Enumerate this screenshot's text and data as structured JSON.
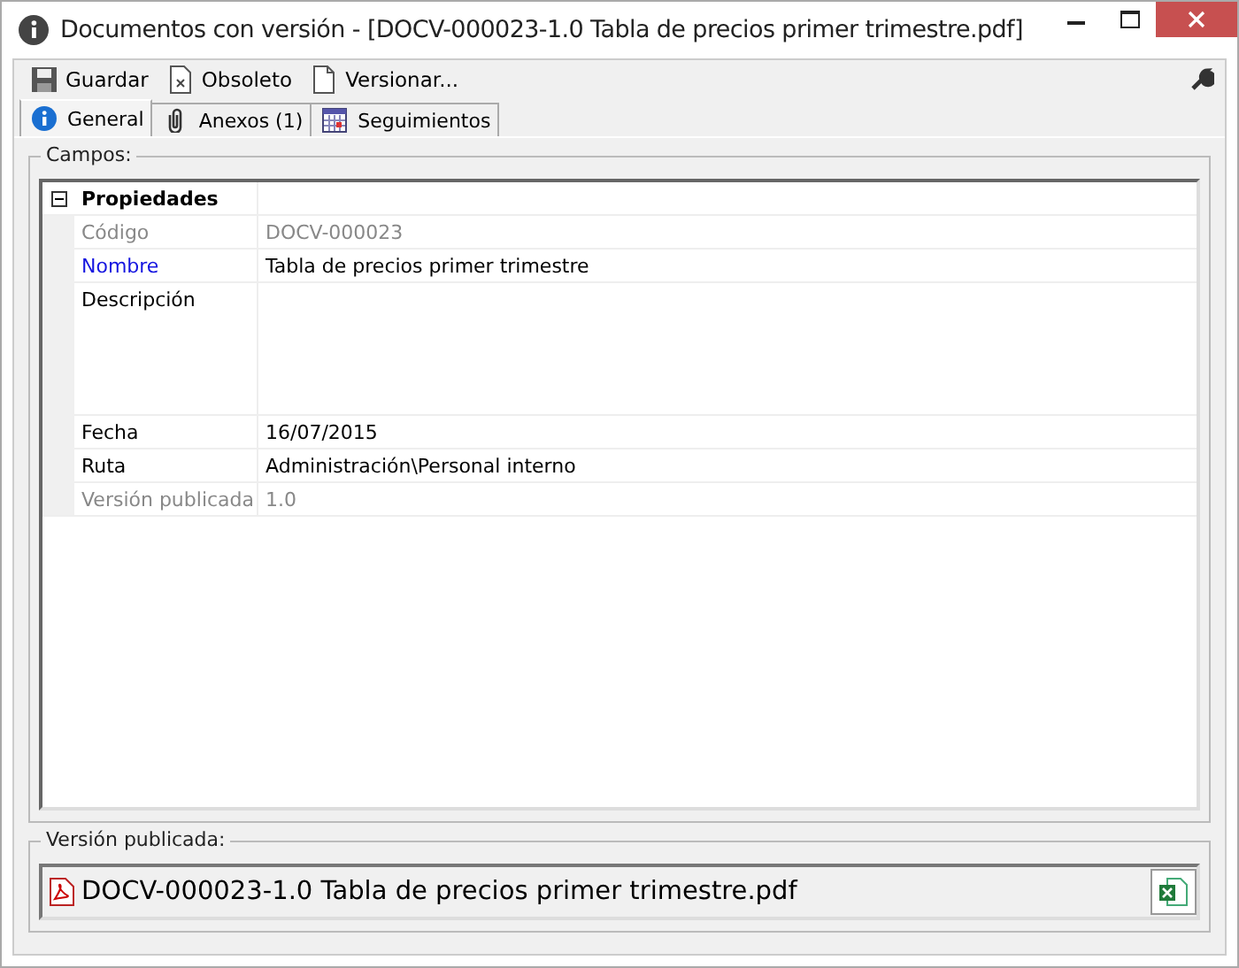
{
  "window": {
    "title": "Documentos con versión - [DOCV-000023-1.0 Tabla de precios primer trimestre.pdf]"
  },
  "toolbar": [
    {
      "label": "Guardar",
      "kind": "save"
    },
    {
      "label": "Obsoleto",
      "kind": "obsolete"
    },
    {
      "label": "Versionar...",
      "kind": "version"
    }
  ],
  "tabs": [
    {
      "label": "General",
      "kind": "info",
      "selected": true
    },
    {
      "label": "Anexos (1)",
      "kind": "clip",
      "selected": false
    },
    {
      "label": "Seguimientos",
      "kind": "calendar",
      "selected": false
    }
  ],
  "fields_group": {
    "title": "Campos:",
    "category": {
      "label": "Propiedades",
      "expanded": true
    },
    "rows": [
      {
        "label": "Código",
        "value": "DOCV-000023",
        "kind": "readonly"
      },
      {
        "label": "Nombre",
        "value": "Tabla de precios primer trimestre",
        "kind": "required"
      },
      {
        "label": "Descripción",
        "kind": "multiline"
      },
      {
        "label": "Fecha",
        "value": "16/07/2015",
        "kind": "text"
      },
      {
        "label": "Ruta",
        "value": "Administración\\Personal interno",
        "kind": "text"
      },
      {
        "label": "Versión publicada",
        "value": "1.0",
        "kind": "readonly"
      }
    ]
  },
  "published_group": {
    "title": "Versión publicada:",
    "file": "DOCV-000023-1.0 Tabla de precios primer trimestre.pdf"
  }
}
